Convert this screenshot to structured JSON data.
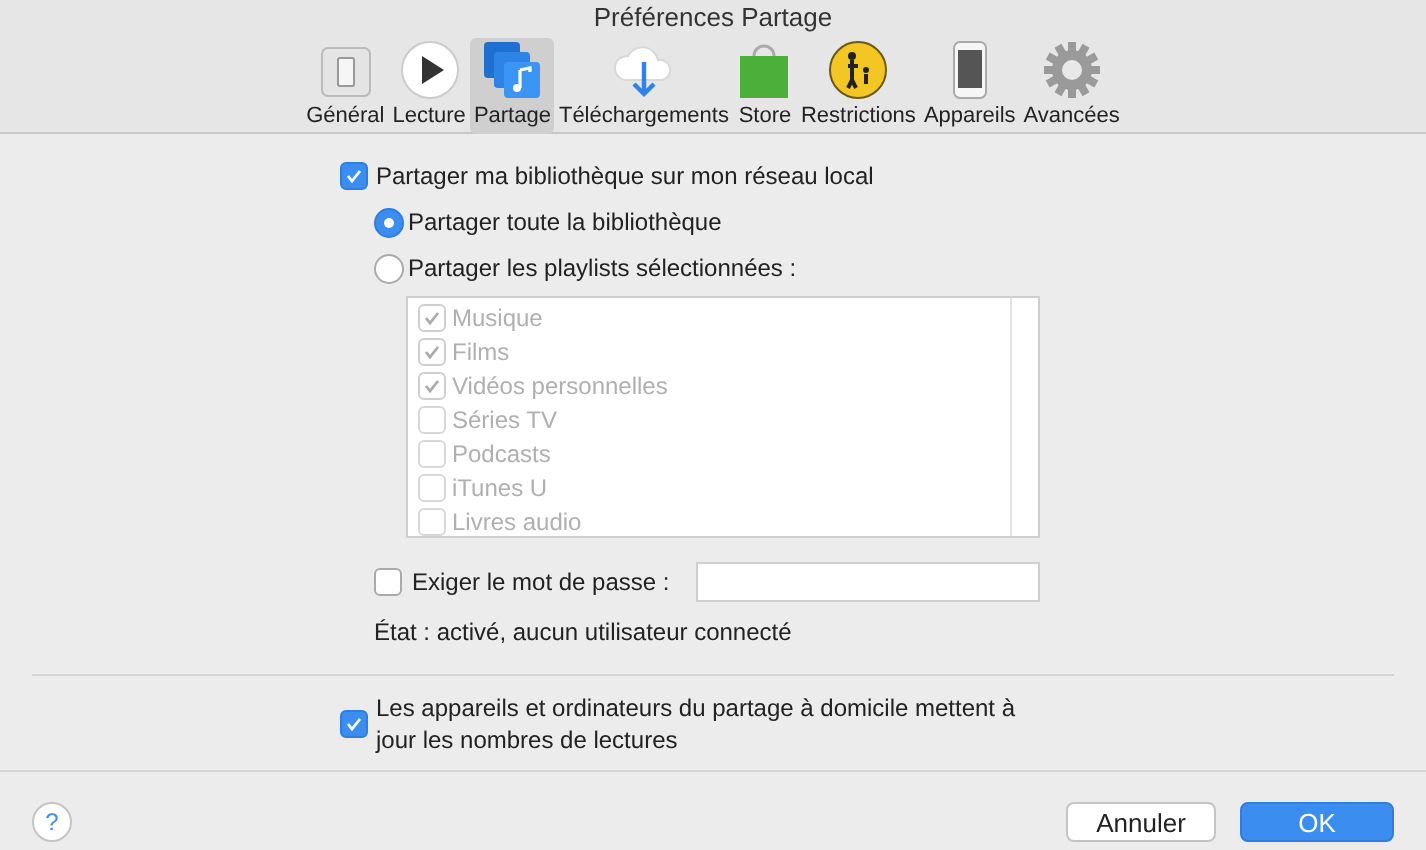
{
  "window": {
    "title": "Préférences Partage"
  },
  "tabs": [
    {
      "label": "Général",
      "kind": "switch",
      "selected": false
    },
    {
      "label": "Lecture",
      "kind": "play",
      "selected": false
    },
    {
      "label": "Partage",
      "kind": "share",
      "selected": true
    },
    {
      "label": "Téléchargements",
      "kind": "download",
      "selected": false
    },
    {
      "label": "Store",
      "kind": "bag",
      "selected": false
    },
    {
      "label": "Restrictions",
      "kind": "parental",
      "selected": false
    },
    {
      "label": "Appareils",
      "kind": "phone",
      "selected": false
    },
    {
      "label": "Avancées",
      "kind": "gear",
      "selected": false
    }
  ],
  "share_library": {
    "label": "Partager ma bibliothèque sur mon réseau local",
    "checked": true
  },
  "share_options": [
    {
      "label": "Partager toute la bibliothèque",
      "selected": true
    },
    {
      "label": "Partager les playlists sélectionnées :",
      "selected": false
    }
  ],
  "playlists": [
    {
      "label": "Musique",
      "checked": true,
      "disabled": true
    },
    {
      "label": "Films",
      "checked": true,
      "disabled": true
    },
    {
      "label": "Vidéos personnelles",
      "checked": true,
      "disabled": true
    },
    {
      "label": "Séries TV",
      "checked": false,
      "disabled": true
    },
    {
      "label": "Podcasts",
      "checked": false,
      "disabled": true
    },
    {
      "label": "iTunes U",
      "checked": false,
      "disabled": true
    },
    {
      "label": "Livres audio",
      "checked": false,
      "disabled": true
    }
  ],
  "password": {
    "label": "Exiger le mot de passe :",
    "checked": false
  },
  "status": "État : activé, aucun utilisateur connecté",
  "update_counts": {
    "label": "Les appareils et ordinateurs du partage à domicile mettent à jour les nombres de lectures",
    "checked": true
  },
  "help_button": "?",
  "buttons": [
    {
      "label": "Annuler",
      "kind": "cancel"
    },
    {
      "label": "OK",
      "kind": "default"
    }
  ]
}
